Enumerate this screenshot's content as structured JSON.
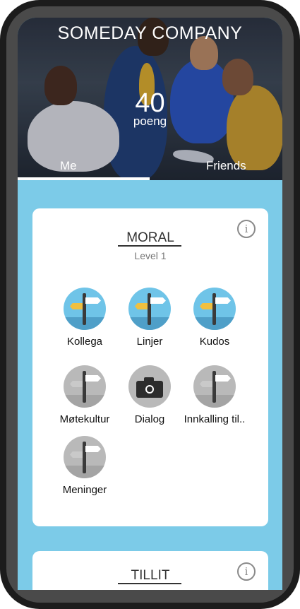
{
  "header": {
    "company": "SOMEDAY COMPANY",
    "score": "40",
    "score_unit": "poeng"
  },
  "tabs": [
    {
      "label": "Me",
      "active": true
    },
    {
      "label": "Friends",
      "active": false
    }
  ],
  "sections": [
    {
      "title": "MORAL",
      "level": "Level 1",
      "badges": [
        {
          "label": "Kollega",
          "icon": "signpost-icon",
          "active": true
        },
        {
          "label": "Linjer",
          "icon": "signpost-icon",
          "active": true
        },
        {
          "label": "Kudos",
          "icon": "signpost-icon",
          "active": true
        },
        {
          "label": "Møtekultur",
          "icon": "signpost-icon",
          "active": false
        },
        {
          "label": "Dialog",
          "icon": "camera-icon",
          "active": false
        },
        {
          "label": "Innkalling til..",
          "icon": "signpost-icon",
          "active": false
        },
        {
          "label": "Meninger",
          "icon": "signpost-icon",
          "active": false
        }
      ]
    },
    {
      "title": "TILLIT"
    }
  ],
  "colors": {
    "background": "#7ccbe8",
    "badge_active": "#6fc4e8",
    "badge_inactive": "#b9b9b9",
    "signpost_active": "#f0c040"
  },
  "info_icon": "info-icon"
}
